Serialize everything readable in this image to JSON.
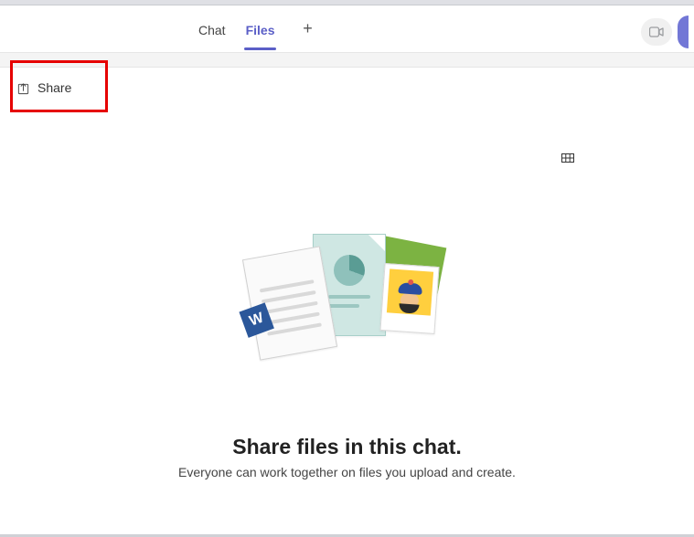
{
  "header": {
    "tabs": [
      {
        "label": "Chat",
        "active": false
      },
      {
        "label": "Files",
        "active": true
      }
    ],
    "add_tab_glyph": "+"
  },
  "toolbar": {
    "share_label": "Share"
  },
  "empty_state": {
    "title": "Share files in this chat.",
    "subtitle": "Everyone can work together on files you upload and create."
  },
  "illustration": {
    "word_badge": "W"
  }
}
